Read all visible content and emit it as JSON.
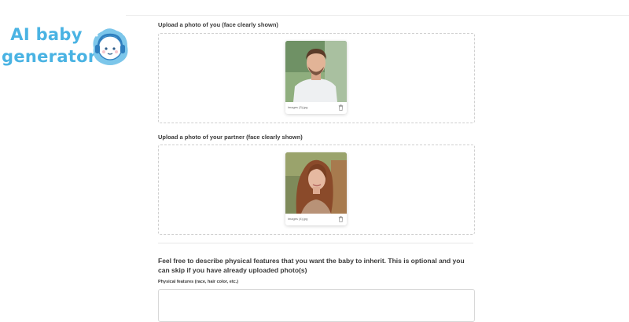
{
  "logo": {
    "line1": "AI baby",
    "line2": "generator",
    "color": "#4ab3e3"
  },
  "upload_you": {
    "label": "Upload a photo of you (face clearly shown)",
    "file_name": "images (3).jpg"
  },
  "upload_partner": {
    "label": "Upload a photo of your partner (face clearly shown)",
    "file_name": "images (4).jpg"
  },
  "features": {
    "description": "Feel free to describe physical features that you want the baby to inherit. This is optional and you can skip if you have already uploaded photo(s)",
    "field_label": "Physical features (race, hair color, etc.)",
    "field_value": ""
  },
  "icons": {
    "remove": "trash-icon",
    "mascot": "baby-headphones-icon"
  }
}
